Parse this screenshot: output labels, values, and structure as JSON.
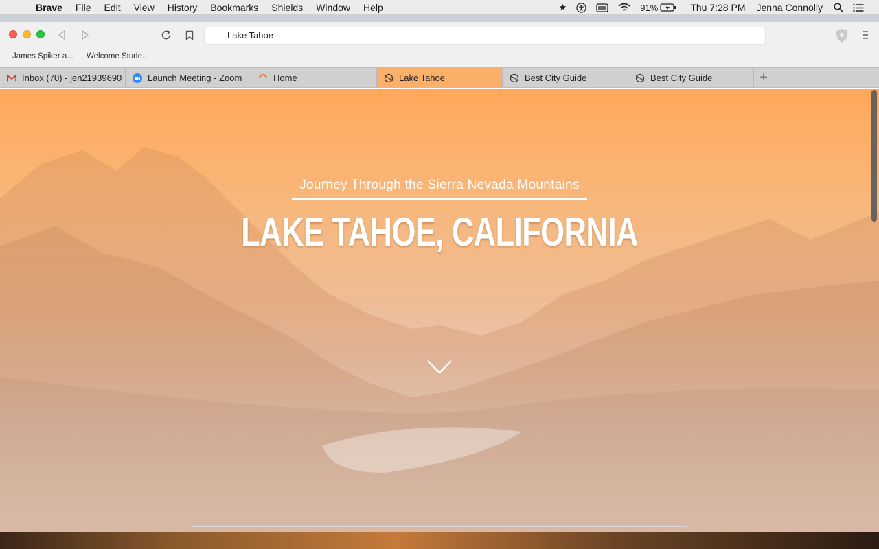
{
  "menubar": {
    "app": "Brave",
    "items": [
      "File",
      "Edit",
      "View",
      "History",
      "Bookmarks",
      "Shields",
      "Window",
      "Help"
    ],
    "battery": "91%",
    "clock": "Thu 7:28 PM",
    "user": "Jenna Connolly"
  },
  "browser": {
    "url": "Lake Tahoe",
    "bookmarks": [
      "James Spiker a...",
      "Welcome Stude..."
    ],
    "tabs": [
      {
        "label": "Inbox (70) - jen21939690",
        "icon": "gmail-icon",
        "active": false
      },
      {
        "label": "Launch Meeting - Zoom",
        "icon": "zoom-icon",
        "active": false
      },
      {
        "label": "Home",
        "icon": "loading-icon",
        "active": false
      },
      {
        "label": "Lake Tahoe",
        "icon": "globe-icon",
        "active": true
      },
      {
        "label": "Best City Guide",
        "icon": "globe-icon",
        "active": false
      },
      {
        "label": "Best City Guide",
        "icon": "globe-icon",
        "active": false
      }
    ],
    "new_tab": "+"
  },
  "hero": {
    "subtitle": "Journey Through the Sierra Nevada Mountains",
    "title": "LAKE TAHOE, CALIFORNIA"
  },
  "colors": {
    "active_tab": "#fbb06a",
    "hero_top": "#ffa85a"
  }
}
